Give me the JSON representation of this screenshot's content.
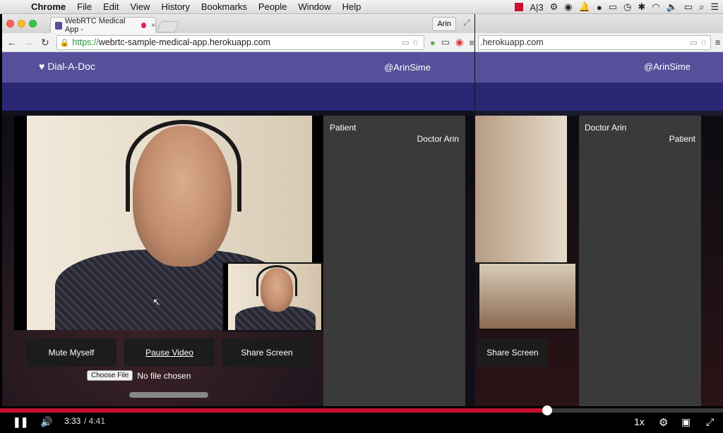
{
  "menubar": {
    "apple": "",
    "app": "Chrome",
    "items": [
      "File",
      "Edit",
      "View",
      "History",
      "Bookmarks",
      "People",
      "Window",
      "Help"
    ],
    "status_ai": "A|3"
  },
  "browser": {
    "tab_title": "WebRTC Medical App -",
    "tab_close": "×",
    "profile": "Arin",
    "url_scheme": "https://",
    "url_rest": "webrtc-sample-medical-app.herokuapp.com",
    "url_partial": ".herokuapp.com"
  },
  "app": {
    "brand": "Dial-A-Doc",
    "user": "@ArinSime"
  },
  "left_window": {
    "panel_label_1": "Patient",
    "panel_label_2": "Doctor Arin",
    "buttons": {
      "mute": "Mute Myself",
      "pause": "Pause Video",
      "share": "Share Screen"
    },
    "file_button": "Choose File",
    "file_status": "No file chosen"
  },
  "right_window": {
    "panel_label_1": "Doctor Arin",
    "panel_label_2": "Patient",
    "share": "Share Screen"
  },
  "player": {
    "current_time": "3:33",
    "total_time": "/ 4:41",
    "progress": 0.757,
    "speed": "1x"
  }
}
